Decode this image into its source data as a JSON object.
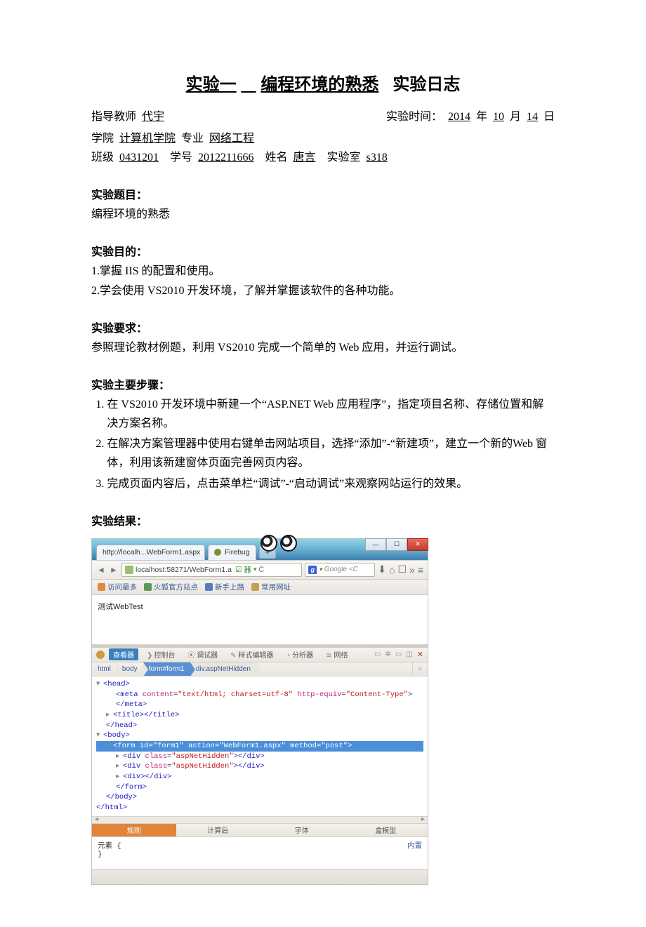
{
  "title": {
    "part1": "实验一",
    "part2": "编程环境的熟悉",
    "part3": "实验日志"
  },
  "meta": {
    "teacher_label": "指导教师",
    "teacher": "代宇",
    "time_label": "实验时间：",
    "year": "2014",
    "year_suffix": "年",
    "month": "10",
    "month_suffix": "月",
    "day": "14",
    "day_suffix": "日",
    "college_label": "学院",
    "college": "计算机学院",
    "major_label": "专业",
    "major": "网络工程",
    "class_label": "班级",
    "class": "0431201",
    "sid_label": "学号",
    "sid": "2012211666",
    "name_label": "姓名",
    "name": "唐言",
    "lab_label": "实验室",
    "lab": "s318"
  },
  "sections": {
    "topic_head": "实验题目：",
    "topic_text": "编程环境的熟悉",
    "purpose_head": "实验目的：",
    "purpose_1": "1.掌握 IIS 的配置和使用。",
    "purpose_2": "2.学会使用 VS2010 开发环境，了解并掌握该软件的各种功能。",
    "require_head": "实验要求：",
    "require_text": "参照理论教材例题，利用 VS2010 完成一个简单的 Web 应用，并运行调试。",
    "steps_head": "实验主要步骤：",
    "step_1": "在 VS2010 开发环境中新建一个“ASP.NET Web 应用程序”，指定项目名称、存储位置和解决方案名称。",
    "step_2": "在解决方案管理器中使用右键单击网站项目，选择“添加”-“新建项”，建立一个新的Web 窗体，利用该新建窗体页面完善网页内容。",
    "step_3": "完成页面内容后，点击菜单栏“调试”-“启动调试”来观察网站运行的效果。",
    "result_head": "实验结果："
  },
  "shot": {
    "win": {
      "min": "—",
      "max": "☐",
      "close": "✕"
    },
    "tabs": {
      "t1": "http://localh...WebForm1.aspx",
      "t2": "Firebug",
      "plus": "+"
    },
    "addr": {
      "back": "◄",
      "fwd": "►",
      "url": "localhost:58271/WebForm1.a",
      "shield": "☑ 器",
      "drop": "▾",
      "reload": "Ċ",
      "search_ph": "Google <C",
      "dl": "⬇",
      "home": "⌂",
      "st1": "☐",
      "st2": "»",
      "menu": "≡"
    },
    "bm": {
      "a": "访问最多",
      "b": "火狐官方站点",
      "c": "新手上路",
      "d": "常用网址"
    },
    "page": "测试WebTest",
    "fb_tabs": {
      "inspect": "查看器",
      "console": "控制台",
      "html": "调试器",
      "style": "样式编辑器",
      "profiler": "分析器",
      "net": "网络",
      "close": "✕"
    },
    "crumbs": {
      "c1": "html",
      "c2": "body",
      "c3": "form#form1",
      "c4": "div.aspNetHidden",
      "search": "⌕"
    },
    "code": {
      "l1a": "▾",
      "l1b": "<head>",
      "l2": "<meta content=\"text/html; charset=utf-8\" http-equiv=\"Content-Type\"></meta>",
      "l3a": "▸",
      "l3b": "<title></title>",
      "l4": "</head>",
      "l5a": "▾",
      "l5b": "<body>",
      "l6": "<form id=\"form1\" action=\"WebForm1.aspx\" method=\"post\">",
      "l7a": "▸",
      "l7b": "<div class=\"aspNetHidden\"></div>",
      "l8a": "▸",
      "l8b": "<div class=\"aspNetHidden\"></div>",
      "l9a": "▸",
      "l9b": "<div></div>",
      "l10": "</form>",
      "l11": "</body>",
      "l12": "</html>"
    },
    "css_tabs": {
      "t1": "规则",
      "t2": "计算后",
      "t3": "字体",
      "t4": "盒模型"
    },
    "css": {
      "selector": "元素 {",
      "close": "}",
      "inherit": "内置"
    }
  }
}
